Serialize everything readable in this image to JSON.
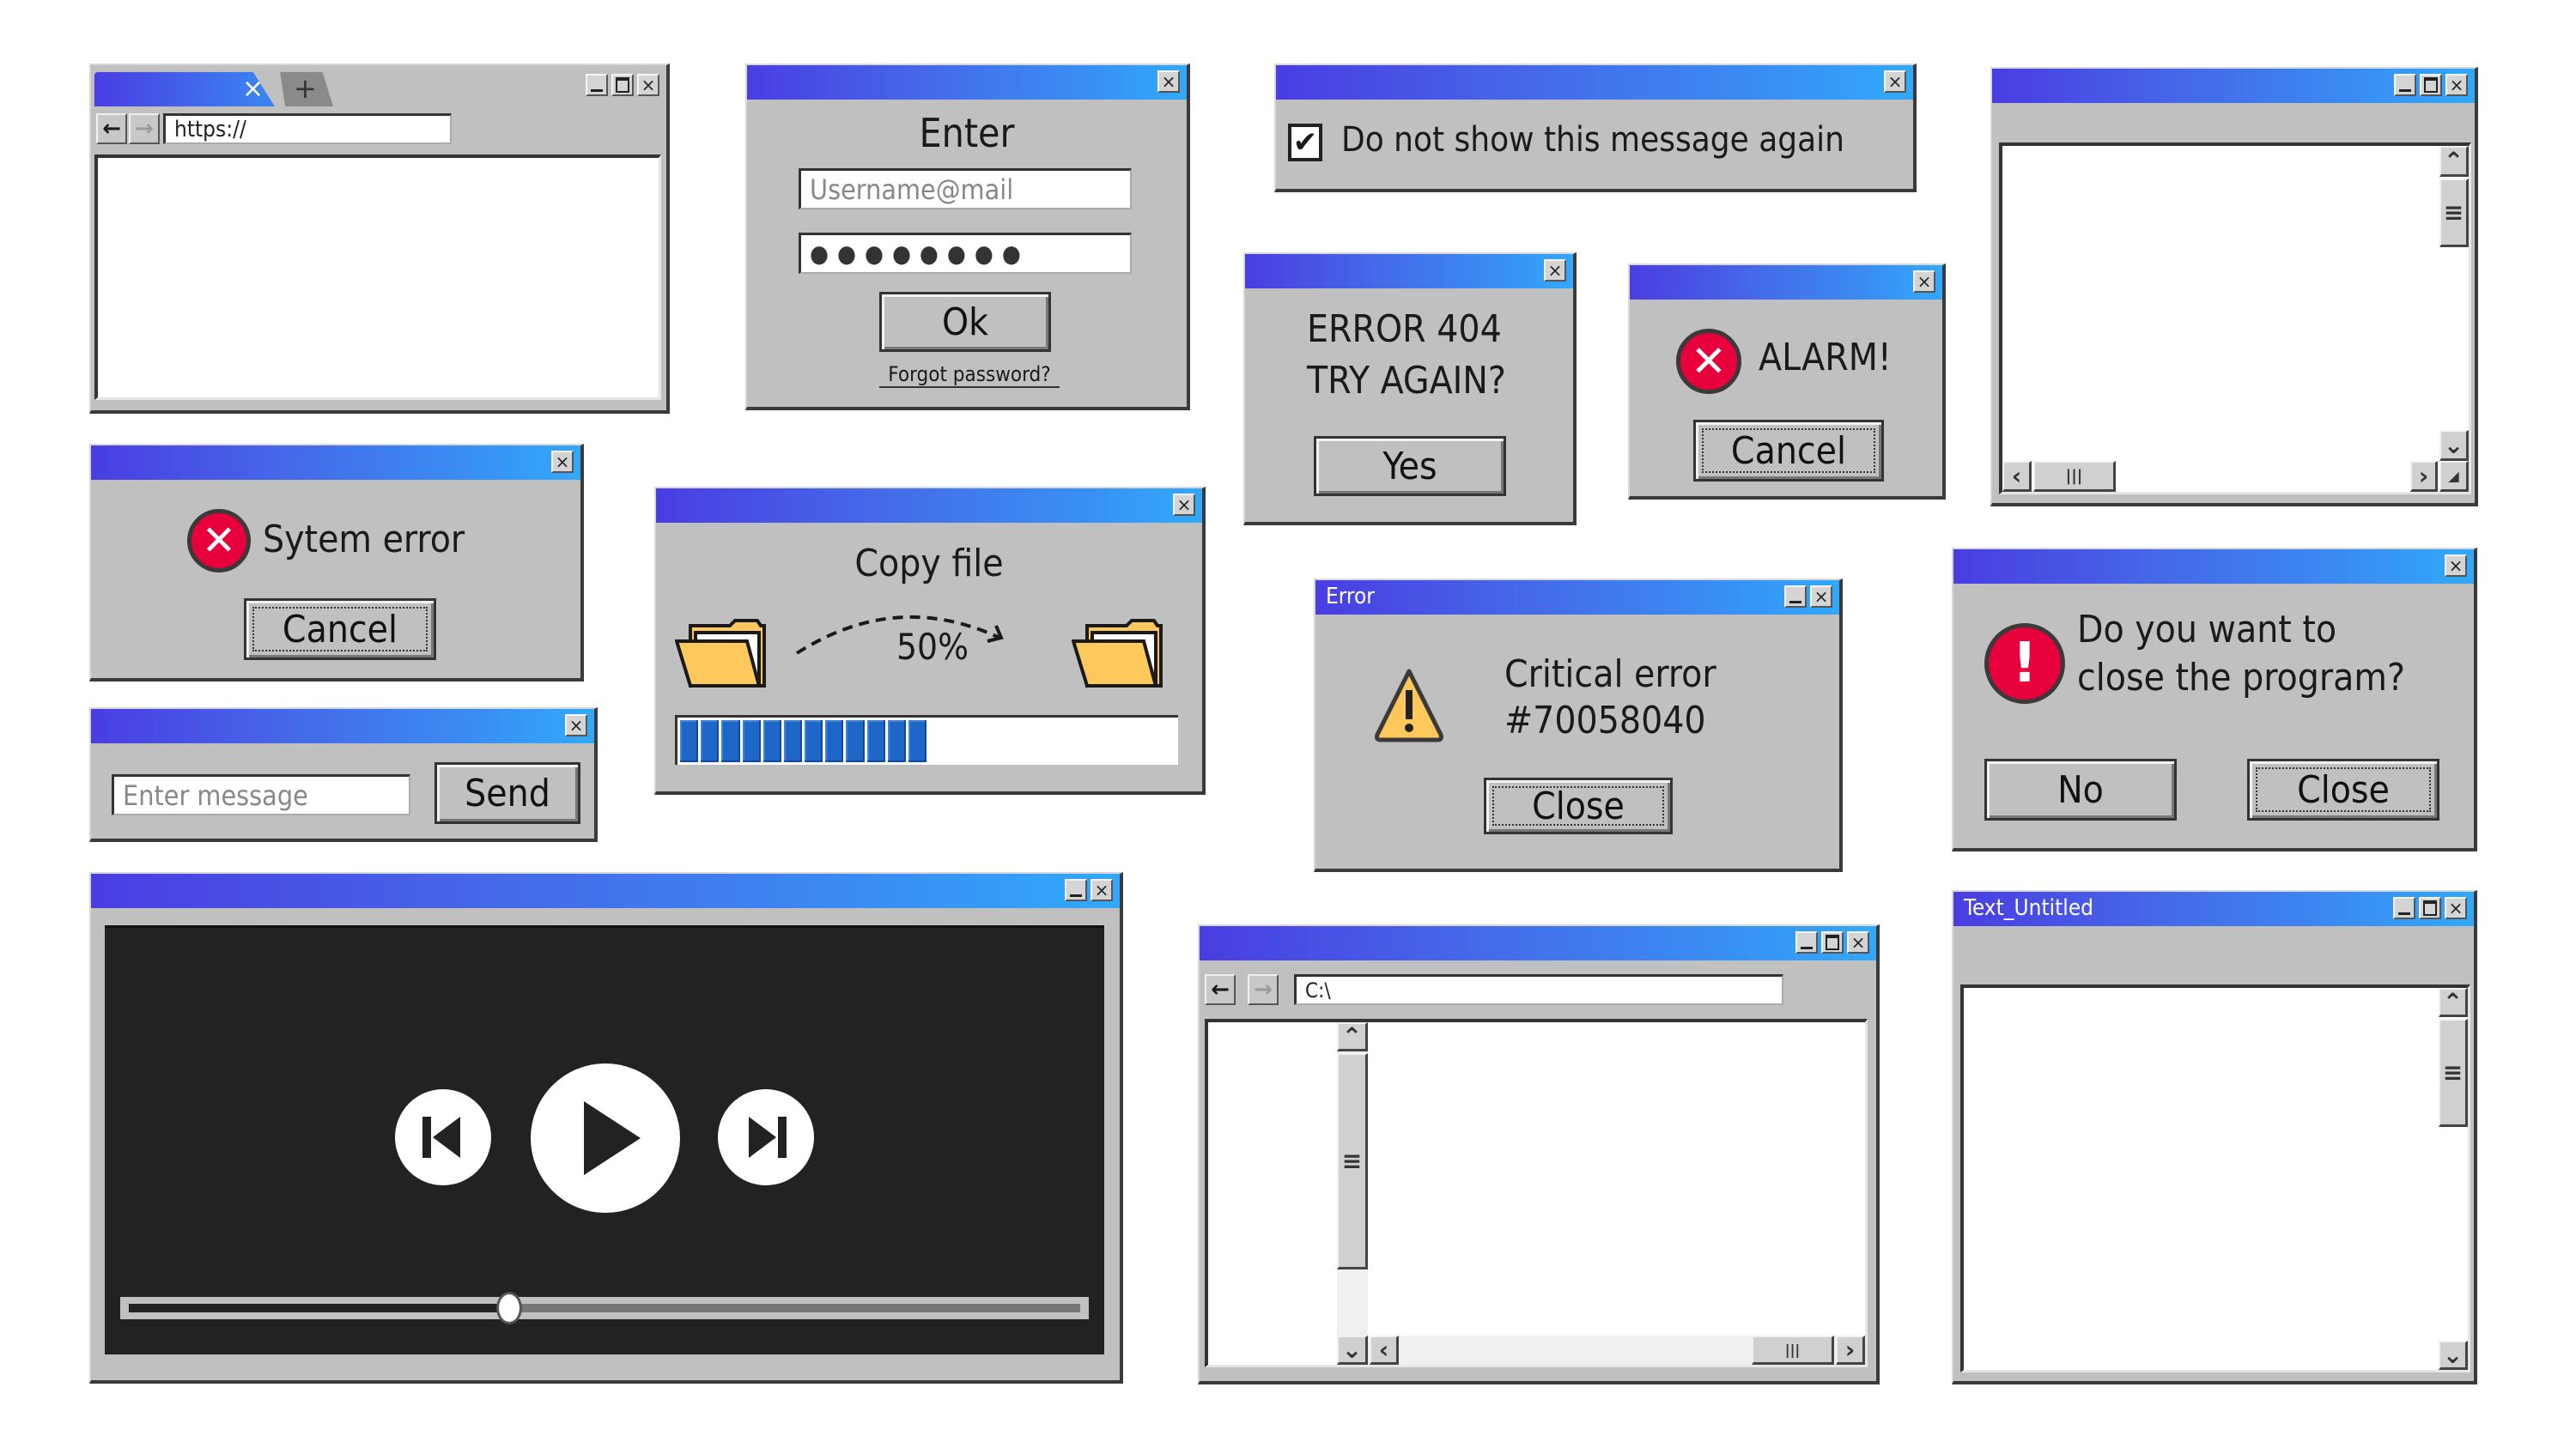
{
  "palette": {
    "titlebar_start": "#4a3de2",
    "titlebar_end": "#31a9fb",
    "window_gray": "#c0c0c0",
    "error_red": "#e8003d",
    "warning_yellow": "#fec85c",
    "folder_yellow": "#fec85c",
    "progress_blue": "#1e66c8",
    "media_bg": "#222222"
  },
  "browser": {
    "tab_close": "×",
    "new_tab": "+",
    "url": "https://",
    "icons": {
      "back": "arrow-left-icon",
      "forward": "arrow-right-icon"
    }
  },
  "login": {
    "close": "×",
    "heading": "Enter",
    "username_placeholder": "Username@mail",
    "password_mask": "● ● ● ● ● ● ● ●",
    "ok_label": "Ok",
    "forgot_link": "Forgot password?"
  },
  "dont_show": {
    "close": "×",
    "checked": true,
    "label": "Do not show this message again"
  },
  "error404": {
    "close": "×",
    "line1": "ERROR 404",
    "line2": "TRY AGAIN?",
    "yes_label": "Yes"
  },
  "alarm": {
    "close": "×",
    "message": "ALARM!",
    "cancel_label": "Cancel"
  },
  "blank_window": {
    "icons": [
      "minimize-icon",
      "maximize-icon",
      "close-icon"
    ]
  },
  "system_error": {
    "close": "×",
    "message": "Sytem error",
    "cancel_label": "Cancel"
  },
  "message_box": {
    "close": "×",
    "placeholder": "Enter message",
    "send_label": "Send"
  },
  "copy_file": {
    "close": "×",
    "title": "Copy file",
    "percent_label": "50%",
    "progress_fraction": 0.5,
    "segments_total": 24,
    "segments_filled": 12
  },
  "critical": {
    "title": "Error",
    "line1": "Critical error",
    "line2": "#70058040",
    "close_label": "Close"
  },
  "close_program": {
    "close": "×",
    "line1": "Do you want to",
    "line2": "close the program?",
    "no_label": "No",
    "close_label": "Close"
  },
  "media_player": {
    "close": "×",
    "seek_fraction": 0.4,
    "controls": [
      "skip-back-icon",
      "play-icon",
      "skip-forward-icon"
    ]
  },
  "explorer": {
    "path": "C:\\"
  },
  "text_editor": {
    "title": "Text_Untitled"
  }
}
